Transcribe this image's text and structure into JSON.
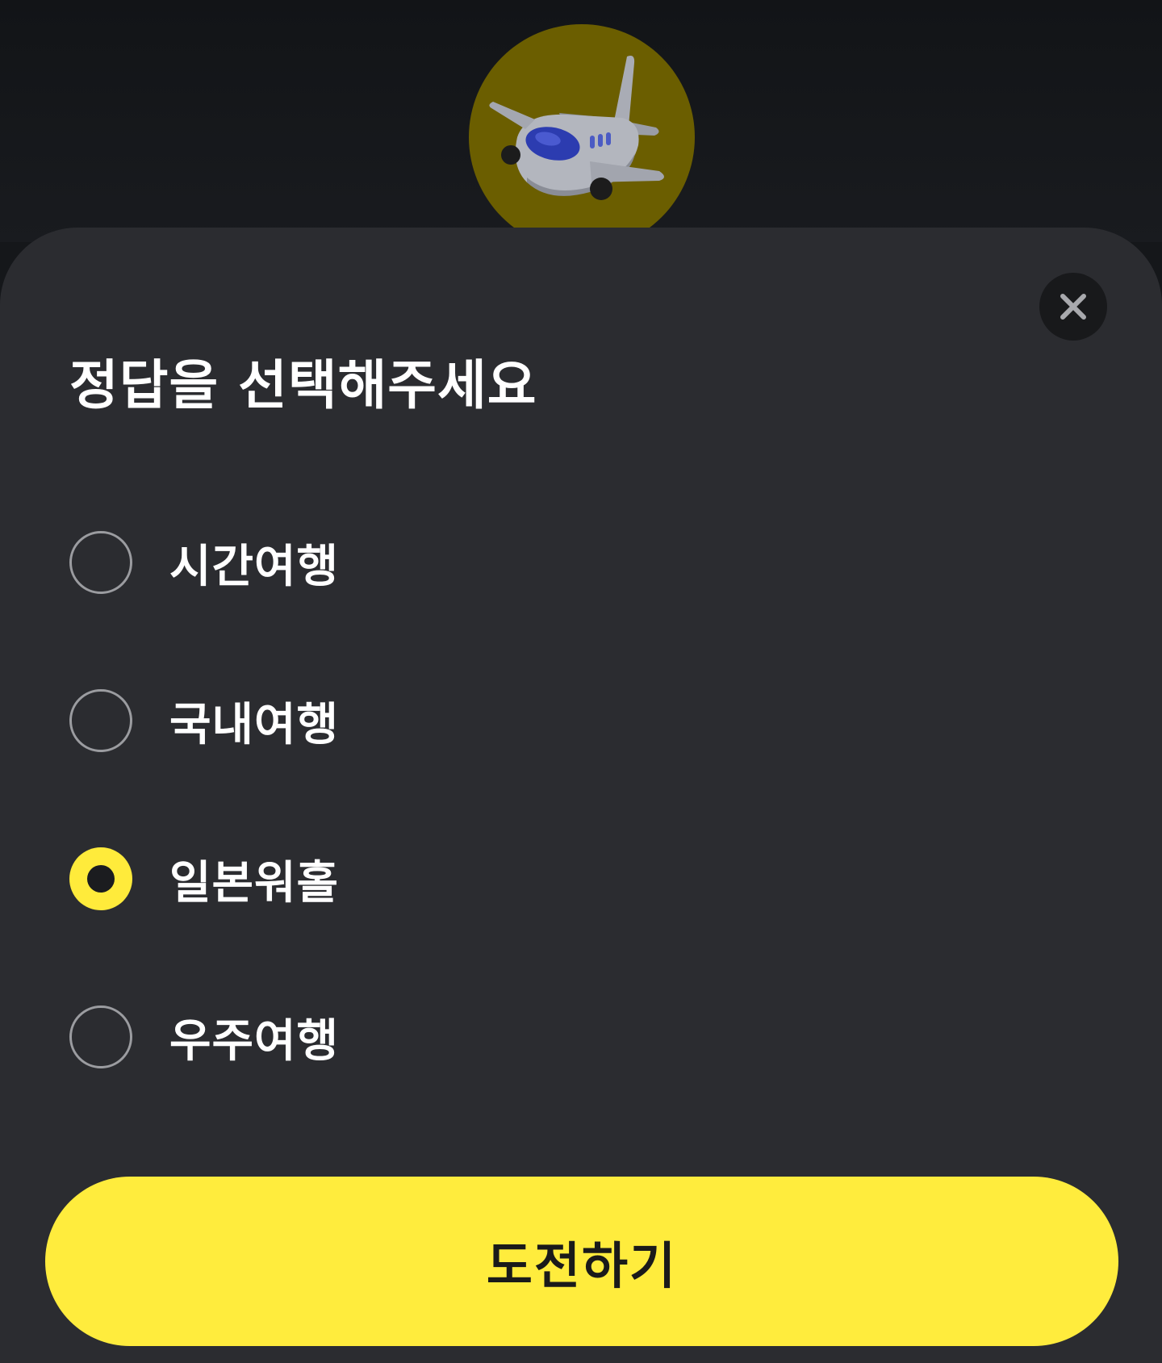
{
  "theme": {
    "accent": "#ffec3d",
    "sheet_bg": "#2b2c30",
    "badge_bg": "#6b5e00"
  },
  "hero": {
    "icon": "airplane-icon"
  },
  "sheet": {
    "close_icon": "close-icon",
    "title": "정답을 선택해주세요",
    "options": [
      {
        "label": "시간여행",
        "selected": false
      },
      {
        "label": "국내여행",
        "selected": false
      },
      {
        "label": "일본워홀",
        "selected": true
      },
      {
        "label": "우주여행",
        "selected": false
      }
    ],
    "submit_label": "도전하기"
  }
}
